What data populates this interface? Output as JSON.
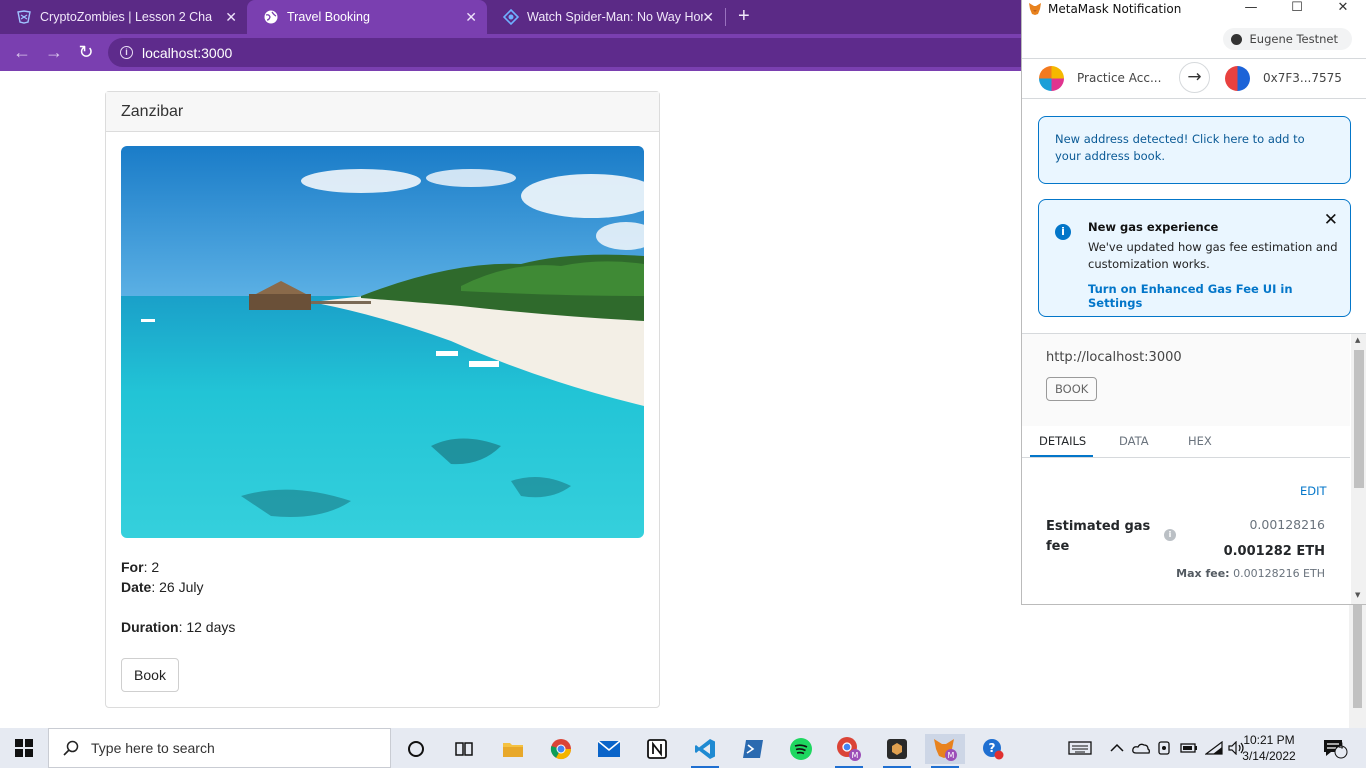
{
  "browser": {
    "tabs": [
      {
        "title": "CryptoZombies | Lesson 2 Chapter",
        "active": false
      },
      {
        "title": "Travel Booking",
        "active": true
      },
      {
        "title": "Watch Spider-Man: No Way Home",
        "active": false
      }
    ],
    "address": "localhost:3000"
  },
  "page": {
    "card_title": "Zanzibar",
    "for_label": "For",
    "for_value": ": 2",
    "date_label": "Date",
    "date_value": ": 26 July",
    "duration_label": "Duration",
    "duration_value": ": 12 days",
    "book_label": "Book"
  },
  "metamask": {
    "window_title": "MetaMask Notification",
    "network": "Eugene Testnet",
    "from_account": "Practice Acc...",
    "to_address": "0x7F3...7575",
    "alert_address": "New address detected! Click here to add to your address book.",
    "alert_gas_title": "New gas experience",
    "alert_gas_body": "We've updated how gas fee estimation and customization works.",
    "alert_gas_link": "Turn on Enhanced Gas Fee UI in Settings",
    "origin": "http://localhost:3000",
    "method": "BOOK",
    "tabs": [
      "DETAILS",
      "DATA",
      "HEX"
    ],
    "edit_label": "EDIT",
    "gas_label": "Estimated gas fee",
    "gas_value_fiat": "0.00128216",
    "gas_value_eth": "0.001282 ETH",
    "max_fee_label": "Max fee:",
    "max_fee_value": "0.00128216 ETH"
  },
  "taskbar": {
    "search_placeholder": "Type here to search",
    "time": "10:21 PM",
    "date": "3/14/2022",
    "notification_count": "4"
  },
  "colors": {
    "chrome_dark": "#5b2a86",
    "chrome_light": "#7a3fb0",
    "metamask_blue": "#0376c9"
  }
}
